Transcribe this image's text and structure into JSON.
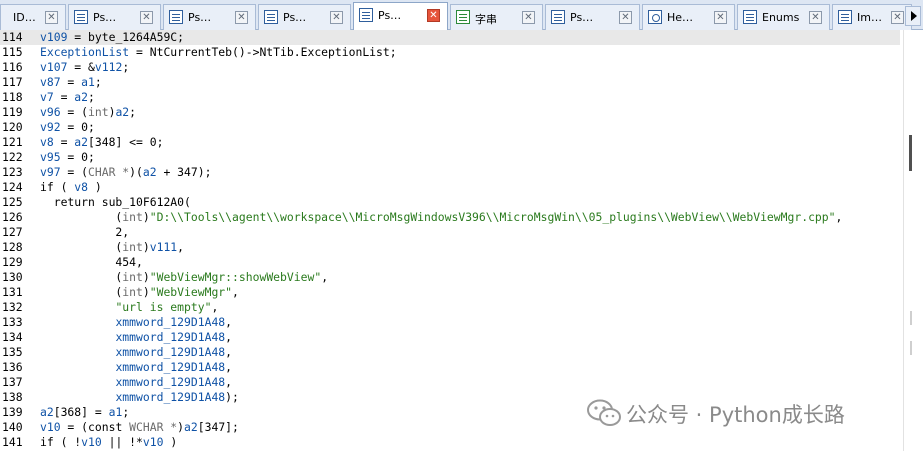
{
  "tabs": [
    {
      "label": "ID…",
      "icon": "none",
      "active": false
    },
    {
      "label": "Ps…",
      "icon": "pseudocode",
      "active": false
    },
    {
      "label": "Ps…",
      "icon": "pseudocode",
      "active": false
    },
    {
      "label": "Ps…",
      "icon": "pseudocode",
      "active": false
    },
    {
      "label": "Ps…",
      "icon": "pseudocode",
      "active": true
    },
    {
      "label": "字串",
      "icon": "strings",
      "active": false
    },
    {
      "label": "Ps…",
      "icon": "pseudocode",
      "active": false
    },
    {
      "label": "He…",
      "icon": "hex",
      "active": false
    },
    {
      "label": "Enums",
      "icon": "enums",
      "active": false
    },
    {
      "label": "Im…",
      "icon": "imports",
      "active": false
    }
  ],
  "tab_close_glyph": "✕",
  "code": {
    "lines": [
      {
        "num": "114",
        "highlighted": true,
        "tokens": [
          {
            "t": "v109",
            "c": "var"
          },
          {
            "t": " = byte_1264A59C;",
            "c": "txt"
          }
        ]
      },
      {
        "num": "115",
        "tokens": [
          {
            "t": "ExceptionList",
            "c": "var"
          },
          {
            "t": " = NtCurrentTeb()->NtTib.ExceptionList;",
            "c": "txt"
          }
        ]
      },
      {
        "num": "116",
        "tokens": [
          {
            "t": "v107",
            "c": "var"
          },
          {
            "t": " = &",
            "c": "txt"
          },
          {
            "t": "v112",
            "c": "var"
          },
          {
            "t": ";",
            "c": "txt"
          }
        ]
      },
      {
        "num": "117",
        "tokens": [
          {
            "t": "v87",
            "c": "var"
          },
          {
            "t": " = ",
            "c": "txt"
          },
          {
            "t": "a1",
            "c": "var"
          },
          {
            "t": ";",
            "c": "txt"
          }
        ]
      },
      {
        "num": "118",
        "tokens": [
          {
            "t": "v7",
            "c": "var"
          },
          {
            "t": " = ",
            "c": "txt"
          },
          {
            "t": "a2",
            "c": "var"
          },
          {
            "t": ";",
            "c": "txt"
          }
        ]
      },
      {
        "num": "119",
        "tokens": [
          {
            "t": "v96",
            "c": "var"
          },
          {
            "t": " = (",
            "c": "txt"
          },
          {
            "t": "int",
            "c": "cast"
          },
          {
            "t": ")",
            "c": "txt"
          },
          {
            "t": "a2",
            "c": "var"
          },
          {
            "t": ";",
            "c": "txt"
          }
        ]
      },
      {
        "num": "120",
        "tokens": [
          {
            "t": "v92",
            "c": "var"
          },
          {
            "t": " = 0;",
            "c": "txt"
          }
        ]
      },
      {
        "num": "121",
        "tokens": [
          {
            "t": "v8",
            "c": "var"
          },
          {
            "t": " = ",
            "c": "txt"
          },
          {
            "t": "a2",
            "c": "var"
          },
          {
            "t": "[348] <= 0;",
            "c": "txt"
          }
        ]
      },
      {
        "num": "122",
        "tokens": [
          {
            "t": "v95",
            "c": "var"
          },
          {
            "t": " = 0;",
            "c": "txt"
          }
        ]
      },
      {
        "num": "123",
        "tokens": [
          {
            "t": "v97",
            "c": "var"
          },
          {
            "t": " = (",
            "c": "txt"
          },
          {
            "t": "CHAR *",
            "c": "cast"
          },
          {
            "t": ")(",
            "c": "txt"
          },
          {
            "t": "a2",
            "c": "var"
          },
          {
            "t": " + 347);",
            "c": "txt"
          }
        ]
      },
      {
        "num": "124",
        "tokens": [
          {
            "t": "if ( ",
            "c": "kw"
          },
          {
            "t": "v8",
            "c": "var"
          },
          {
            "t": " )",
            "c": "txt"
          }
        ]
      },
      {
        "num": "125",
        "tokens": [
          {
            "t": "  return sub_10F612A0(",
            "c": "txt"
          }
        ]
      },
      {
        "num": "126",
        "tokens": [
          {
            "t": "           (",
            "c": "txt"
          },
          {
            "t": "int",
            "c": "cast"
          },
          {
            "t": ")",
            "c": "txt"
          },
          {
            "t": "\"D:\\\\Tools\\\\agent\\\\workspace\\\\MicroMsgWindowsV396\\\\MicroMsgWin\\\\05_plugins\\\\WebView\\\\WebViewMgr.cpp\"",
            "c": "str"
          },
          {
            "t": ",",
            "c": "txt"
          }
        ]
      },
      {
        "num": "127",
        "tokens": [
          {
            "t": "           2,",
            "c": "txt"
          }
        ]
      },
      {
        "num": "128",
        "tokens": [
          {
            "t": "           (",
            "c": "txt"
          },
          {
            "t": "int",
            "c": "cast"
          },
          {
            "t": ")",
            "c": "txt"
          },
          {
            "t": "v111",
            "c": "var"
          },
          {
            "t": ",",
            "c": "txt"
          }
        ]
      },
      {
        "num": "129",
        "tokens": [
          {
            "t": "           454,",
            "c": "txt"
          }
        ]
      },
      {
        "num": "130",
        "tokens": [
          {
            "t": "           (",
            "c": "txt"
          },
          {
            "t": "int",
            "c": "cast"
          },
          {
            "t": ")",
            "c": "txt"
          },
          {
            "t": "\"WebViewMgr::showWebView\"",
            "c": "str"
          },
          {
            "t": ",",
            "c": "txt"
          }
        ]
      },
      {
        "num": "131",
        "tokens": [
          {
            "t": "           (",
            "c": "txt"
          },
          {
            "t": "int",
            "c": "cast"
          },
          {
            "t": ")",
            "c": "txt"
          },
          {
            "t": "\"WebViewMgr\"",
            "c": "str"
          },
          {
            "t": ",",
            "c": "txt"
          }
        ]
      },
      {
        "num": "132",
        "tokens": [
          {
            "t": "           ",
            "c": "txt"
          },
          {
            "t": "\"url is empty\"",
            "c": "str"
          },
          {
            "t": ",",
            "c": "txt"
          }
        ]
      },
      {
        "num": "133",
        "tokens": [
          {
            "t": "           ",
            "c": "txt"
          },
          {
            "t": "xmmword_129D1A48",
            "c": "var"
          },
          {
            "t": ",",
            "c": "txt"
          }
        ]
      },
      {
        "num": "134",
        "tokens": [
          {
            "t": "           ",
            "c": "txt"
          },
          {
            "t": "xmmword_129D1A48",
            "c": "var"
          },
          {
            "t": ",",
            "c": "txt"
          }
        ]
      },
      {
        "num": "135",
        "tokens": [
          {
            "t": "           ",
            "c": "txt"
          },
          {
            "t": "xmmword_129D1A48",
            "c": "var"
          },
          {
            "t": ",",
            "c": "txt"
          }
        ]
      },
      {
        "num": "136",
        "tokens": [
          {
            "t": "           ",
            "c": "txt"
          },
          {
            "t": "xmmword_129D1A48",
            "c": "var"
          },
          {
            "t": ",",
            "c": "txt"
          }
        ]
      },
      {
        "num": "137",
        "tokens": [
          {
            "t": "           ",
            "c": "txt"
          },
          {
            "t": "xmmword_129D1A48",
            "c": "var"
          },
          {
            "t": ",",
            "c": "txt"
          }
        ]
      },
      {
        "num": "138",
        "tokens": [
          {
            "t": "           ",
            "c": "txt"
          },
          {
            "t": "xmmword_129D1A48",
            "c": "var"
          },
          {
            "t": ");",
            "c": "txt"
          }
        ]
      },
      {
        "num": "139",
        "tokens": [
          {
            "t": "a2",
            "c": "var"
          },
          {
            "t": "[368] = ",
            "c": "txt"
          },
          {
            "t": "a1",
            "c": "var"
          },
          {
            "t": ";",
            "c": "txt"
          }
        ]
      },
      {
        "num": "140",
        "tokens": [
          {
            "t": "v10",
            "c": "var"
          },
          {
            "t": " = (const ",
            "c": "txt"
          },
          {
            "t": "WCHAR *",
            "c": "cast"
          },
          {
            "t": ")",
            "c": "txt"
          },
          {
            "t": "a2",
            "c": "var"
          },
          {
            "t": "[347];",
            "c": "txt"
          }
        ]
      },
      {
        "num": "141",
        "tokens": [
          {
            "t": "if ( !",
            "c": "kw"
          },
          {
            "t": "v10",
            "c": "var"
          },
          {
            "t": " || !*",
            "c": "txt"
          },
          {
            "t": "v10",
            "c": "var"
          },
          {
            "t": " )",
            "c": "txt"
          }
        ]
      }
    ]
  },
  "watermark": {
    "text": "公众号 · Python成长路",
    "icon": "wechat-logo"
  },
  "colors": {
    "variable": "#0f52a6",
    "string": "#2a7a1d",
    "cast": "#6b6b6b",
    "highlight": "#e8e8e8",
    "active_close": "#e6543b"
  }
}
